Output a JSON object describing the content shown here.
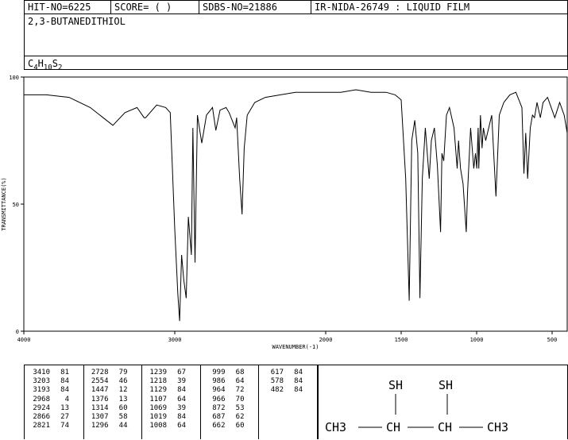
{
  "header": {
    "hit_no": "HIT-NO=6225",
    "score": "SCORE=  (   )",
    "sdbs_no": "SDBS-NO=21886",
    "ir_nida": "IR-NIDA-26749 : LIQUID FILM"
  },
  "compound": {
    "name": "2,3-BUTANEDITHIOL",
    "formula_parts": [
      "C",
      "4",
      "H",
      "10",
      "S",
      "2"
    ]
  },
  "chart_data": {
    "type": "line",
    "xlabel": "WAVENUMBER(-1)",
    "ylabel": "TRANSMITTANCE(%)",
    "xlim": [
      4000,
      400
    ],
    "ylim": [
      0,
      100
    ],
    "xticks": [
      4000,
      3000,
      2000,
      1500,
      1000,
      500
    ],
    "yticks": [
      0,
      50,
      100
    ],
    "x": [
      4000,
      3850,
      3700,
      3560,
      3410,
      3330,
      3250,
      3203,
      3193,
      3120,
      3060,
      3030,
      3000,
      2980,
      2968,
      2955,
      2940,
      2924,
      2910,
      2890,
      2880,
      2866,
      2850,
      2821,
      2790,
      2750,
      2728,
      2700,
      2660,
      2640,
      2600,
      2590,
      2570,
      2554,
      2540,
      2520,
      2470,
      2400,
      2300,
      2200,
      2100,
      2000,
      1900,
      1800,
      1700,
      1600,
      1540,
      1500,
      1470,
      1447,
      1430,
      1410,
      1390,
      1376,
      1360,
      1340,
      1314,
      1300,
      1280,
      1260,
      1239,
      1230,
      1218,
      1200,
      1180,
      1150,
      1129,
      1120,
      1107,
      1090,
      1069,
      1060,
      1040,
      1019,
      1008,
      999,
      990,
      986,
      975,
      964,
      955,
      940,
      900,
      872,
      850,
      820,
      780,
      740,
      700,
      687,
      675,
      662,
      645,
      630,
      617,
      600,
      578,
      560,
      530,
      482,
      450,
      420,
      400
    ],
    "y": [
      93,
      93,
      92,
      88,
      81,
      86,
      88,
      84,
      84,
      89,
      88,
      86,
      40,
      15,
      4,
      30,
      20,
      13,
      45,
      30,
      80,
      27,
      85,
      74,
      85,
      88,
      79,
      87,
      88,
      86,
      80,
      84,
      60,
      46,
      72,
      85,
      90,
      92,
      93,
      94,
      94,
      94,
      94,
      95,
      94,
      94,
      93,
      91,
      60,
      12,
      75,
      83,
      70,
      13,
      60,
      80,
      60,
      75,
      80,
      65,
      39,
      70,
      67,
      85,
      88,
      80,
      64,
      75,
      64,
      58,
      39,
      55,
      80,
      64,
      70,
      64,
      80,
      64,
      85,
      72,
      80,
      75,
      85,
      53,
      85,
      90,
      93,
      94,
      88,
      62,
      78,
      60,
      80,
      85,
      84,
      90,
      84,
      90,
      92,
      84,
      90,
      85,
      78
    ]
  },
  "peak_table": {
    "columns": [
      [
        [
          "3410",
          "81"
        ],
        [
          "3203",
          "84"
        ],
        [
          "3193",
          "84"
        ],
        [
          "2968",
          "4"
        ],
        [
          "2924",
          "13"
        ],
        [
          "2866",
          "27"
        ],
        [
          "2821",
          "74"
        ]
      ],
      [
        [
          "2728",
          "79"
        ],
        [
          "2554",
          "46"
        ],
        [
          "1447",
          "12"
        ],
        [
          "1376",
          "13"
        ],
        [
          "1314",
          "60"
        ],
        [
          "1307",
          "58"
        ],
        [
          "1296",
          "44"
        ]
      ],
      [
        [
          "1239",
          "67"
        ],
        [
          "1218",
          "39"
        ],
        [
          "1129",
          "84"
        ],
        [
          "1107",
          "64"
        ],
        [
          "1069",
          "39"
        ],
        [
          "1019",
          "84"
        ],
        [
          "1008",
          "64"
        ]
      ],
      [
        [
          "999",
          "68"
        ],
        [
          "986",
          "64"
        ],
        [
          "964",
          "72"
        ],
        [
          "966",
          "70"
        ],
        [
          "872",
          "53"
        ],
        [
          "687",
          "62"
        ],
        [
          "662",
          "60"
        ]
      ],
      [
        [
          "617",
          "84"
        ],
        [
          "578",
          "84"
        ],
        [
          "482",
          "84"
        ]
      ]
    ]
  },
  "structure": {
    "sh1": "SH",
    "sh2": "SH",
    "ch3_left": "CH3",
    "ch1": "CH",
    "ch2": "CH",
    "ch3_right": "CH3"
  }
}
